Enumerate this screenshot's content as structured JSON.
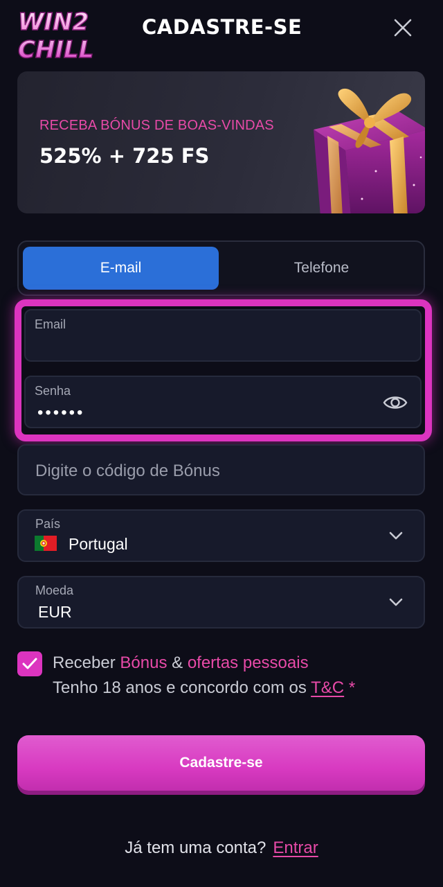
{
  "header": {
    "logo_line1": "WIN2",
    "logo_line2": "CHILL",
    "title": "CADASTRE-SE"
  },
  "banner": {
    "subtitle": "RECEBA BÓNUS DE BOAS-VINDAS",
    "offer": "525% + 725 FS"
  },
  "tabs": [
    {
      "label": "E-mail",
      "active": true
    },
    {
      "label": "Telefone",
      "active": false
    }
  ],
  "form": {
    "email_label": "Email",
    "email_value": "",
    "password_label": "Senha",
    "password_value": "••••••",
    "bonus_placeholder": "Digite o código de Bónus",
    "country_label": "País",
    "country_value": "Portugal",
    "currency_label": "Moeda",
    "currency_value": "EUR"
  },
  "consent": {
    "checked": true,
    "prefix": "Receber",
    "bonus_link": "Bónus",
    "amp": "&",
    "offers_link": "ofertas pessoais",
    "age_text": "Tenho 18 anos e concordo com os",
    "tc_link": "T&C",
    "required_mark": "*"
  },
  "submit_label": "Cadastre-se",
  "footer": {
    "question": "Já tem uma conta?",
    "login_link": "Entrar"
  },
  "colors": {
    "background": "#0d0d18",
    "accent_pink": "#dc34bf",
    "tab_active": "#2b6fd8",
    "field_bg": "#171a2b"
  },
  "icons": [
    "close-icon",
    "gift-image",
    "eye-icon",
    "portugal-flag-icon",
    "chevron-down-icon",
    "check-icon"
  ]
}
